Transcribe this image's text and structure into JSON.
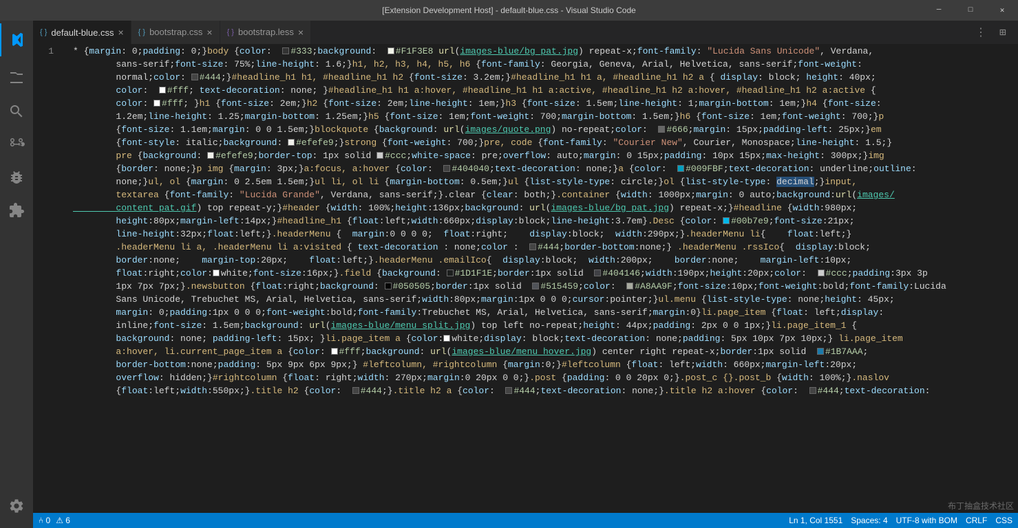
{
  "titleBar": {
    "title": "[Extension Development Host] - default-blue.css - Visual Studio Code",
    "minimize": "─",
    "maximize": "□",
    "close": "✕"
  },
  "tabs": [
    {
      "id": "default-blue-css",
      "label": "default-blue.css",
      "type": "css",
      "active": true,
      "modified": false
    },
    {
      "id": "bootstrap-css",
      "label": "bootstrap.css",
      "type": "css",
      "active": false,
      "modified": false
    },
    {
      "id": "bootstrap-less",
      "label": "bootstrap.less",
      "type": "less",
      "active": false,
      "modified": false
    }
  ],
  "activityBar": {
    "items": [
      {
        "id": "vscode-logo",
        "icon": "vscode",
        "active": false
      },
      {
        "id": "explorer",
        "icon": "files",
        "active": false
      },
      {
        "id": "search",
        "icon": "search",
        "active": false
      },
      {
        "id": "source-control",
        "icon": "source-control",
        "active": false
      },
      {
        "id": "debug",
        "icon": "debug",
        "active": false
      },
      {
        "id": "extensions",
        "icon": "extensions",
        "active": false
      },
      {
        "id": "settings",
        "icon": "settings",
        "active": false,
        "bottom": true
      }
    ]
  },
  "statusBar": {
    "left": [
      {
        "id": "git-branch",
        "text": "⑃ 0"
      },
      {
        "id": "errors",
        "text": "⚠ 6"
      }
    ],
    "right": [
      {
        "id": "cursor-pos",
        "text": "Ln 1, Col 1551"
      },
      {
        "id": "spaces",
        "text": "Spaces: 4"
      },
      {
        "id": "encoding",
        "text": "UTF-8 with BOM"
      },
      {
        "id": "line-ending",
        "text": "CRLF"
      },
      {
        "id": "language",
        "text": "CSS"
      }
    ]
  },
  "lineNumber": "1",
  "outline": "outline"
}
